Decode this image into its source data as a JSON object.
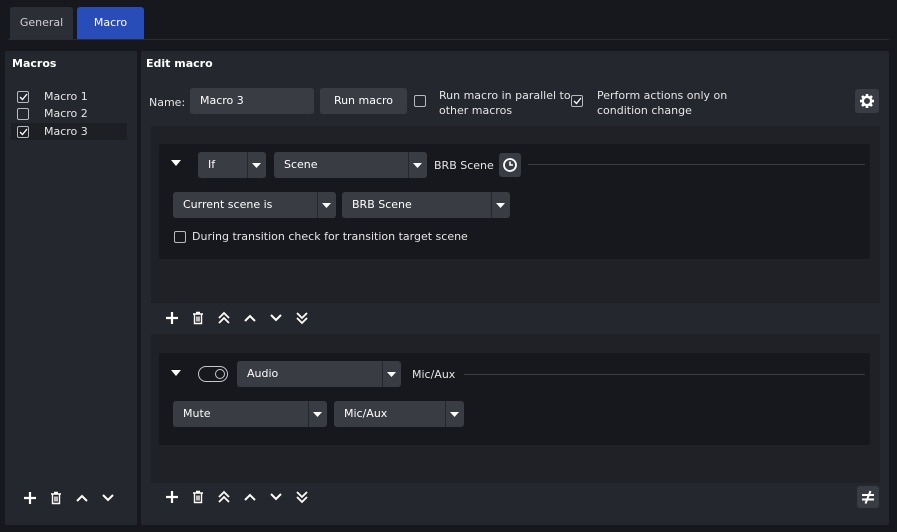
{
  "tabs": [
    {
      "label": "General"
    },
    {
      "label": "Macro"
    }
  ],
  "macros_panel": {
    "title": "Macros",
    "items": [
      {
        "label": "Macro 1",
        "checked": true
      },
      {
        "label": "Macro 2",
        "checked": false
      },
      {
        "label": "Macro 3",
        "checked": true
      }
    ]
  },
  "edit_macro": {
    "title": "Edit macro",
    "name_label": "Name:",
    "name_value": "Macro 3",
    "run_button": "Run macro",
    "parallel_label_1": "Run macro in parallel to",
    "parallel_label_2": "other macros",
    "parallel_checked": false,
    "perform_label_1": "Perform actions only on",
    "perform_label_2": "condition change",
    "perform_checked": true
  },
  "condition": {
    "logic": "If",
    "type": "Scene",
    "summary": "BRB Scene",
    "check_type": "Current scene is",
    "scene": "BRB Scene",
    "transition_label": "During transition check for transition target scene"
  },
  "action": {
    "type": "Audio",
    "summary": "Mic/Aux",
    "action_type": "Mute",
    "source": "Mic/Aux"
  },
  "colors": {
    "accent": "#284cb8",
    "panel": "#25272e",
    "background": "#17181d"
  }
}
